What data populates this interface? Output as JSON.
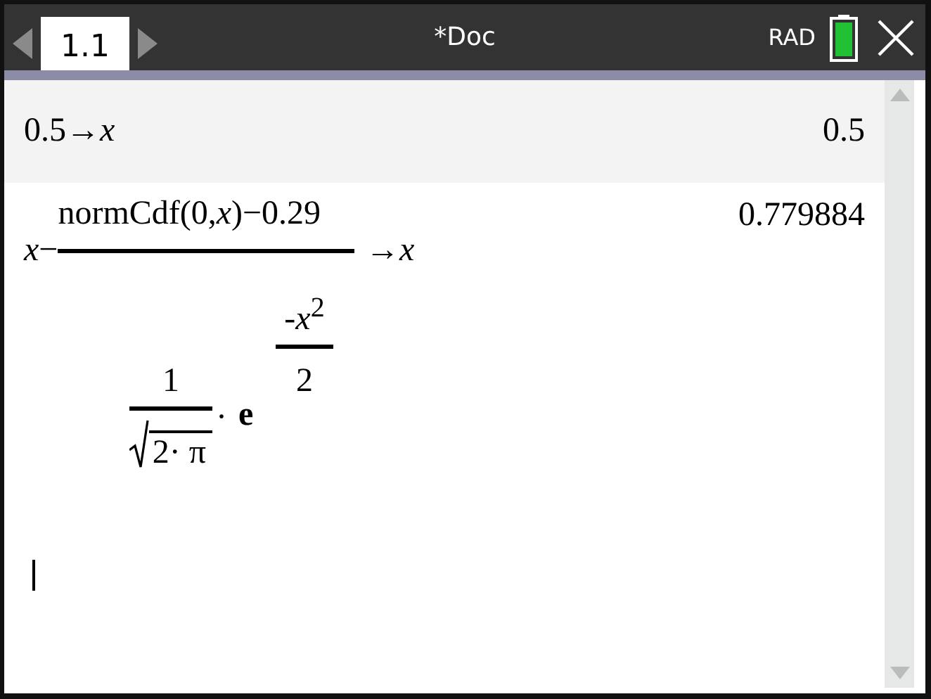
{
  "window": {
    "tabs": [
      {
        "label": "1.1",
        "selected": true
      }
    ],
    "title": "*Doc",
    "angle_mode": "RAD"
  },
  "entries": [
    {
      "kind": "plain",
      "selected": true,
      "input": "0.5→*x*",
      "result": "0.5"
    },
    {
      "kind": "update",
      "selected": false,
      "input": {
        "prefix": "*x*−",
        "numerator": "normCdf(0,*x*)−0.29",
        "target": "→*x*",
        "coefficient_numerator": "1",
        "radicand": "2· π",
        "dot": "·",
        "base": "e",
        "exponent_numerator": "-*x*$^{2}$",
        "exponent_denominator": "2"
      },
      "result": "0.779884"
    }
  ],
  "input_line": {
    "cursor": true
  }
}
